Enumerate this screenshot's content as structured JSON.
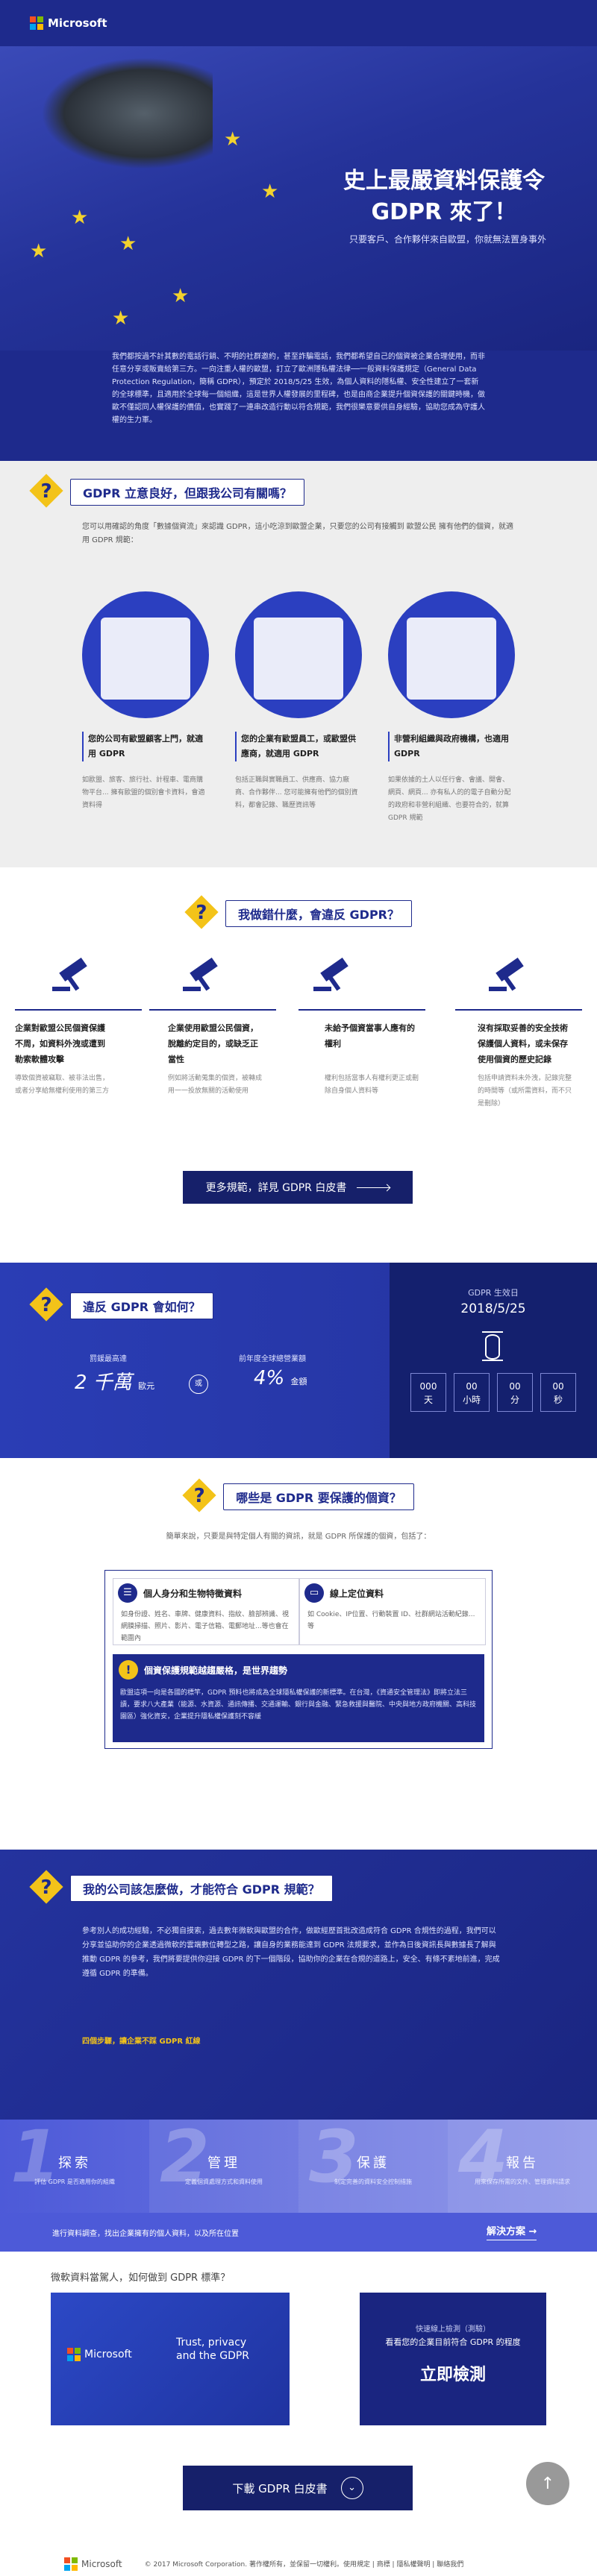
{
  "header": {
    "brand": "Microsoft"
  },
  "hero": {
    "title_line1": "史上最嚴資料保護令",
    "title_line2": "GDPR 來了！",
    "subtitle": "只要客戶、合作夥伴來自歐盟，你就無法置身事外"
  },
  "intro": {
    "text": "我們都按過不計其數的電話行銷、不明的社群邀約，甚至詐騙電話，我們都希望自己的個資被企業合理使用，而非任意分享或販賣給第三方。一向注重人權的歐盟，訂立了歐洲隱私權法律──一般資料保護規定（General Data Protection Regulation，簡稱 GDPR），預定於 2018/5/25 生效，為個人資料的隱私權、安全性建立了一套新的全球標準，且適用於全球每一個組織，這是世界人權發展的里程碑，也是由商企業提升個資保護的關鍵時機，做歐不僅認同人權保護的價值，也實踐了一連串改造行動以符合規範，我們很樂意要供自身經驗，協助您成為守護人權的生力軍。"
  },
  "sec2": {
    "title": "GDPR 立意良好，但跟我公司有關嗎？",
    "text": "您可以用確認的角度「數據個資流」來認識 GDPR，這小吃涼到歐盟企業，只要您的公司有接觸到 歐盟公民 擁有他們的個資，就適用 GDPR 規範：",
    "cards": [
      {
        "title": "您的公司有歐盟顧客上門，就適用 GDPR",
        "body": "如歐盟、旅客、旅行社、計程車、電商購物平台... 擁有歐盟的個別會卡資料，會適資料得"
      },
      {
        "title": "您的企業有歐盟員工，或歐盟供應商，就適用 GDPR",
        "body": "包括正職與實職員工、供應商、協力廠商、合作夥伴... 您可能擁有他們的個別資料，都會記錄、職歷資訊等"
      },
      {
        "title": "非營利組織與政府機構，也適用 GDPR",
        "body": "如果依據的土人以任行會、會議、開會、網頁、網頁... 亦有私人的的電子自動分配的政府和非營利組織、也要符合的，就算 GDPR 規範"
      }
    ]
  },
  "sec3": {
    "title": "我做錯什麼，會違反 GDPR？",
    "items": [
      {
        "title": "企業對歐盟公民個資保護不周，如資料外洩或遭到勒索軟體攻擊",
        "body": "導致個資被竊取、被非法出售，或者分享給無權利使用的第三方"
      },
      {
        "title": "企業使用歐盟公民個資，脫離約定目的，或缺乏正當性",
        "body": "例如將活動蒐集的個資，被轉成用一一投放無關的活動使用"
      },
      {
        "title": "未給予個資當事人應有的權利",
        "body": "權利包括當事人有權利更正或刪除自身個人資料等"
      },
      {
        "title": "沒有採取妥善的安全技術保護個人資料，或未保存使用個資的歷史記錄",
        "body": "包括申請資料未外洩，記錄完整的時間等（或所需資料，而不只是刪除）"
      }
    ],
    "button": "更多規範，詳見 GDPR 白皮書"
  },
  "sec4": {
    "title": "違反 GDPR 會如何？",
    "fine_label": "罰鍰最高達",
    "fine_value": "2 千萬",
    "fine_unit": "歐元",
    "or": "或",
    "rev_label": "前年度全球總營業額",
    "rev_value": "4%",
    "rev_unit": "金額",
    "countdown": {
      "label": "GDPR 生效日",
      "date": "2018/5/25",
      "boxes": [
        {
          "v": "000",
          "u": "天"
        },
        {
          "v": "00",
          "u": "小時"
        },
        {
          "v": "00",
          "u": "分"
        },
        {
          "v": "00",
          "u": "秒"
        }
      ]
    }
  },
  "sec5": {
    "title": "哪些是 GDPR 要保護的個資？",
    "sub": "簡單來說，只要是與特定個人有關的資訊，就是 GDPR 所保護的個資，包括了：",
    "a_title": "個人身分和生物特徵資料",
    "a_body": "如身份證、姓名、車牌、健康資料、指紋、臉部辨識、視網膜掃描、照片、影片、電子信箱、電郵地址...等也會在範圍內",
    "b_title": "線上定位資料",
    "b_body": "如 Cookie、IP位置、行動裝置 ID、社群網站活動紀錄...等",
    "c_title": "個資保護規範越趨嚴格，是世界趨勢",
    "c_body": "歐盟這項一向是各國的標竿，GDPR 預料也將成為全球隱私權保護的新標準。在台灣，《資通安全管理法》即將立法三讀，要求八大產業（能源、水資源、通訊傳播、交通運輸、銀行與金融、緊急救援與醫院、中央與地方政府機關、高科技園區）強化資安，企業提升隱私權保護刻不容緩"
  },
  "sec6": {
    "title": "我的公司該怎麼做，才能符合 GDPR 規範？",
    "text": "參考別人的成功經驗，不必獨自摸索，過去數年微軟與歐盟的合作，做歐經歷首批改造成符合 GDPR 合規性的過程，我們可以分享並協助你的企業透過微軟的雲端數位轉型之路，讓自身的業務能達到 GDPR 法規要求，並作為日後資訊長與數據長了解與推動 GDPR 的參考，我們將要提供你迎接 GDPR 的下一個階段，協助你的企業在合規的道路上，安全、有條不紊地前進，完成遵循 GDPR 的準備。",
    "steps_label": "四個步驟，讓企業不踩 GDPR 紅線",
    "steps": [
      {
        "n": "1",
        "t": "探索",
        "d": "評估 GDPR 是否適用你的組織"
      },
      {
        "n": "2",
        "t": "管理",
        "d": "定義個資處理方式和資料使用"
      },
      {
        "n": "3",
        "t": "保護",
        "d": "制定完善的資料安全控制措施"
      },
      {
        "n": "4",
        "t": "報告",
        "d": "用來保存所需的文件、管理資料請求"
      }
    ],
    "bar_text": "進行資料調查，找出企業擁有的個人資料，以及所在位置",
    "bar_link": "解決方案"
  },
  "sec7": {
    "question": "微軟資料當駕人，如何做到 GDPR 標準？",
    "video_brand": "Microsoft",
    "video_text": "Trust, privacy and the GDPR",
    "check_small": "快速線上檢測（測驗）",
    "check_text": "看看您的企業目前符合 GDPR 的程度",
    "check_button": "立即檢測",
    "download": "下載 GDPR 白皮書",
    "to_top": "↑"
  },
  "footer": {
    "brand": "Microsoft",
    "copy": "© 2017 Microsoft Corporation. 著作權所有，並保留一切權利。使用規定 | 商標 | 隱私權聲明 | 聯絡我們"
  },
  "colors": {
    "navy": "#1e2a8c",
    "yellow": "#f3c319",
    "blue": "#2b3fc0"
  }
}
